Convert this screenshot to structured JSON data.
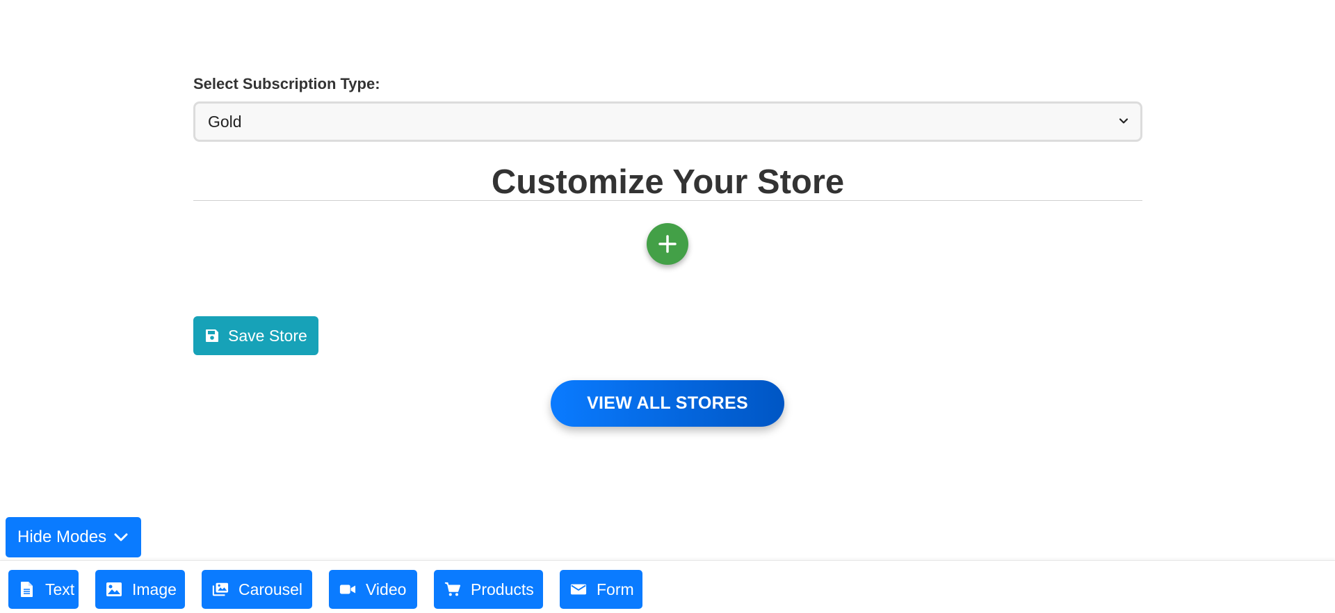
{
  "form": {
    "subscription_label": "Select Subscription Type:",
    "subscription_value": "Gold"
  },
  "section": {
    "title": "Customize Your Store"
  },
  "actions": {
    "save_label": "Save Store",
    "view_all_label": "VIEW ALL STORES"
  },
  "modes": {
    "toggle_label": "Hide Modes",
    "items": [
      {
        "label": "Text",
        "icon": "file-text-icon"
      },
      {
        "label": "Image",
        "icon": "image-icon"
      },
      {
        "label": "Carousel",
        "icon": "images-icon"
      },
      {
        "label": "Video",
        "icon": "video-camera-icon"
      },
      {
        "label": "Products",
        "icon": "shopping-cart-icon"
      },
      {
        "label": "Form",
        "icon": "envelope-icon"
      }
    ]
  },
  "colors": {
    "primary": "#0a7bff",
    "save": "#17a2b8",
    "add": "#43a047"
  }
}
